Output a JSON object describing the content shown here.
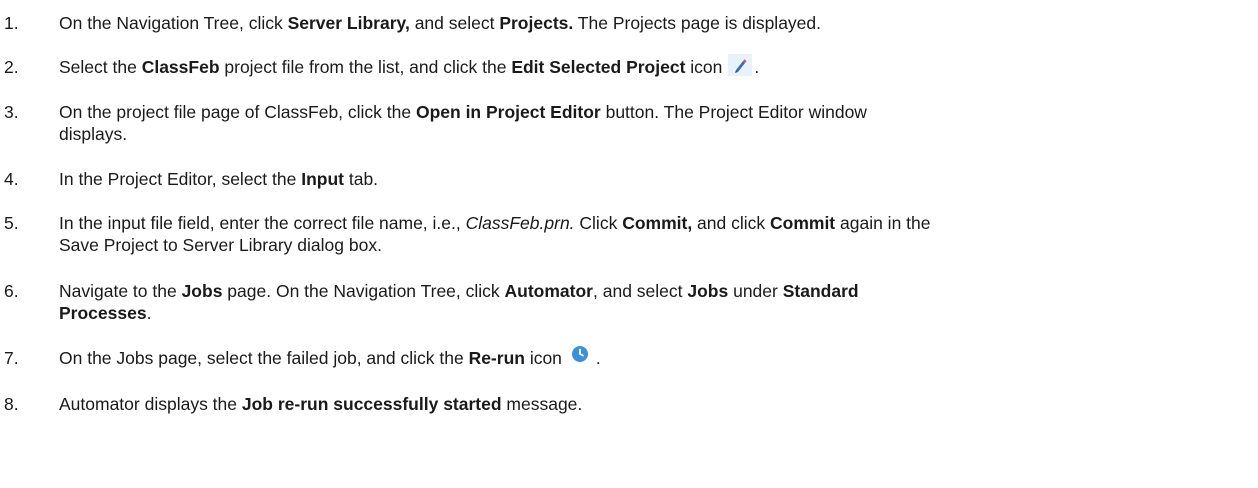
{
  "steps": [
    {
      "number": "1.",
      "parts": [
        {
          "t": "On the Navigation Tree, click "
        },
        {
          "t": "Server Library,",
          "b": true
        },
        {
          "t": " and select "
        },
        {
          "t": "Projects.",
          "b": true
        },
        {
          "t": " The Projects page is displayed."
        }
      ]
    },
    {
      "number": "2.",
      "parts": [
        {
          "t": "Select the "
        },
        {
          "t": "ClassFeb",
          "b": true
        },
        {
          "t": " project file from the list, and click the "
        },
        {
          "t": "Edit Selected Project",
          "b": true
        },
        {
          "t": " icon"
        },
        {
          "icon": "pencil-icon"
        },
        {
          "t": "."
        }
      ]
    },
    {
      "number": "3.",
      "parts": [
        {
          "t": "On the project file page of ClassFeb, click the "
        },
        {
          "t": "Open in Project Editor",
          "b": true
        },
        {
          "t": " button. The Project Editor window"
        },
        {
          "br": true
        },
        {
          "t": "displays."
        }
      ]
    },
    {
      "number": "4.",
      "parts": [
        {
          "t": "In the Project Editor, select the "
        },
        {
          "t": "Input",
          "b": true
        },
        {
          "t": " tab."
        }
      ]
    },
    {
      "number": "5.",
      "parts": [
        {
          "t": "In the input file field, enter the correct file name, i.e., "
        },
        {
          "t": "ClassFeb.prn.",
          "i": true
        },
        {
          "t": " Click "
        },
        {
          "t": "Commit,",
          "b": true
        },
        {
          "t": " and click "
        },
        {
          "t": "Commit",
          "b": true
        },
        {
          "t": " again in the"
        },
        {
          "br": true
        },
        {
          "t": "Save Project to Server Library dialog box."
        }
      ]
    },
    {
      "number": "6.",
      "parts": [
        {
          "t": "Navigate to the "
        },
        {
          "t": "Jobs",
          "b": true
        },
        {
          "t": " page. On the Navigation Tree, click "
        },
        {
          "t": "Automator",
          "b": true
        },
        {
          "t": ", and select "
        },
        {
          "t": "Jobs",
          "b": true
        },
        {
          "t": " under "
        },
        {
          "t": "Standard",
          "b": true
        },
        {
          "br": true
        },
        {
          "t": "Processes",
          "b": true
        },
        {
          "t": "."
        }
      ]
    },
    {
      "number": "7.",
      "parts": [
        {
          "t": "On the Jobs page, select the failed job, and click the "
        },
        {
          "t": "Re-run",
          "b": true
        },
        {
          "t": " icon"
        },
        {
          "icon": "clock-icon"
        },
        {
          "t": "."
        }
      ]
    },
    {
      "number": "8.",
      "parts": [
        {
          "t": "Automator displays the "
        },
        {
          "t": "Job re-run successfully started",
          "b": true
        },
        {
          "t": " message."
        }
      ]
    }
  ],
  "colors": {
    "text": "#1a1a1a",
    "pencil_icon_bg": "#e9f1fa",
    "pencil_icon_fg": "#3a6fb0",
    "clock_icon_fg": "#3d8fd6"
  }
}
